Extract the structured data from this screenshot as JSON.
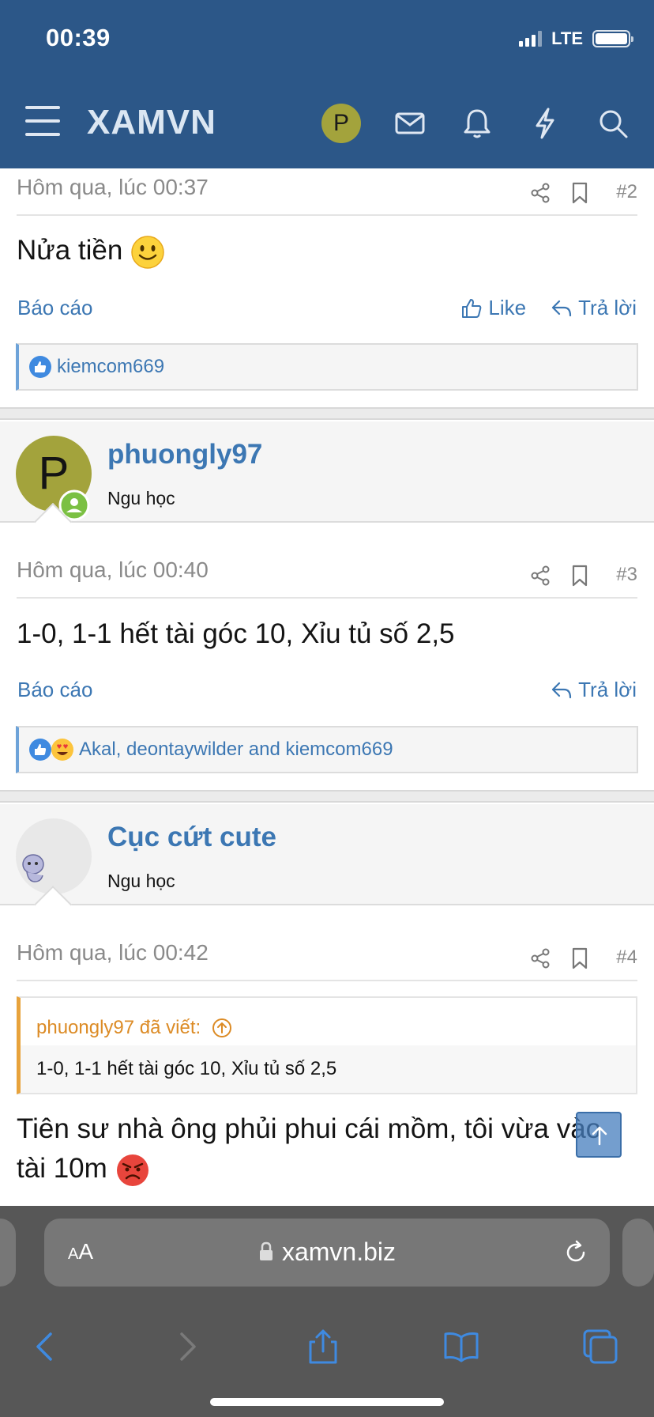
{
  "status_bar": {
    "time": "00:39",
    "network": "LTE"
  },
  "header": {
    "logo": "XAMVN",
    "avatar_letter": "P"
  },
  "posts": [
    {
      "time": "Hôm qua, lúc 00:37",
      "number": "#2",
      "content": "Nửa tiền",
      "report": "Báo cáo",
      "like": "Like",
      "reply": "Trả lời",
      "reactions": "kiemcom669"
    },
    {
      "author": "phuongly97",
      "author_title": "Ngu học",
      "avatar_letter": "P",
      "time": "Hôm qua, lúc 00:40",
      "number": "#3",
      "content": "1-0, 1-1 hết tài góc 10, Xỉu tủ số 2,5",
      "report": "Báo cáo",
      "reply": "Trả lời",
      "reactions": "Akal, deontaywilder and kiemcom669"
    },
    {
      "author": "Cục cứt cute",
      "author_title": "Ngu học",
      "time": "Hôm qua, lúc 00:42",
      "number": "#4",
      "quote_author": "phuongly97 đã viết:",
      "quote_text": "1-0, 1-1 hết tài góc 10, Xỉu tủ số 2,5",
      "content_line1": "Tiên sư nhà ông phủi phui cái mồm, tôi vừa vào",
      "content_line2": "tài 10m"
    }
  ],
  "browser": {
    "text_size": "AA",
    "url": "xamvn.biz"
  },
  "colors": {
    "header_bg": "#2c5788",
    "link": "#3c77b3",
    "quote_accent": "#e8a33c",
    "avatar": "#a3a33c"
  }
}
